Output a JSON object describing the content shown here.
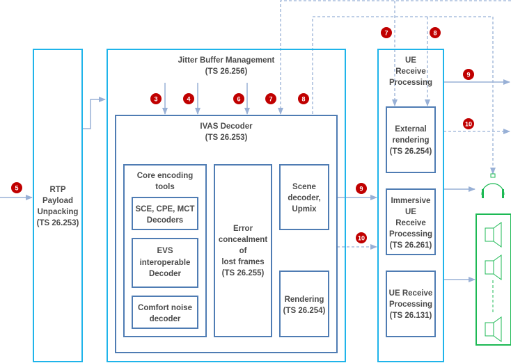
{
  "colors": {
    "outer_box": "#1fb4ea",
    "inner_box": "#4f7cb3",
    "arrow": "#98b0d6",
    "badge": "#c00000",
    "device": "#1db954"
  },
  "rtp": {
    "lines": [
      "RTP",
      "Payload",
      "Unpacking",
      "(TS 26.253)"
    ]
  },
  "jbm": {
    "lines": [
      "Jitter Buffer Management",
      "(TS 26.256)"
    ]
  },
  "ivas": {
    "lines": [
      "IVAS Decoder",
      "(TS 26.253)"
    ]
  },
  "core": {
    "lines": [
      "Core encoding",
      "tools"
    ]
  },
  "sce": {
    "lines": [
      "SCE, CPE, MCT",
      "Decoders"
    ]
  },
  "evs": {
    "lines": [
      "EVS",
      "interoperable",
      "Decoder"
    ]
  },
  "cng": {
    "lines": [
      "Comfort noise",
      "decoder"
    ]
  },
  "error": {
    "lines": [
      "Error",
      "concealment",
      "of",
      "lost frames",
      "(TS 26.255)"
    ]
  },
  "scene": {
    "lines": [
      "Scene",
      "decoder,",
      "Upmix"
    ]
  },
  "rendering": {
    "lines": [
      "Rendering",
      "(TS 26.254)"
    ]
  },
  "ue": {
    "lines": [
      "UE",
      "Receive",
      "Processing"
    ]
  },
  "external": {
    "lines": [
      "External",
      "rendering",
      "(TS 26.254)"
    ]
  },
  "immersive": {
    "lines": [
      "Immersive",
      "UE",
      "Receive",
      "Processing",
      "(TS 26.261)"
    ]
  },
  "ue131": {
    "lines": [
      "UE Receive",
      "Processing",
      "(TS 26.131)"
    ]
  },
  "badges": [
    "5",
    "3",
    "4",
    "6",
    "7",
    "8",
    "9",
    "10",
    "7",
    "8",
    "9",
    "10"
  ],
  "icons": {
    "headphones": "headphones-icon",
    "speaker": "speaker-icon"
  }
}
